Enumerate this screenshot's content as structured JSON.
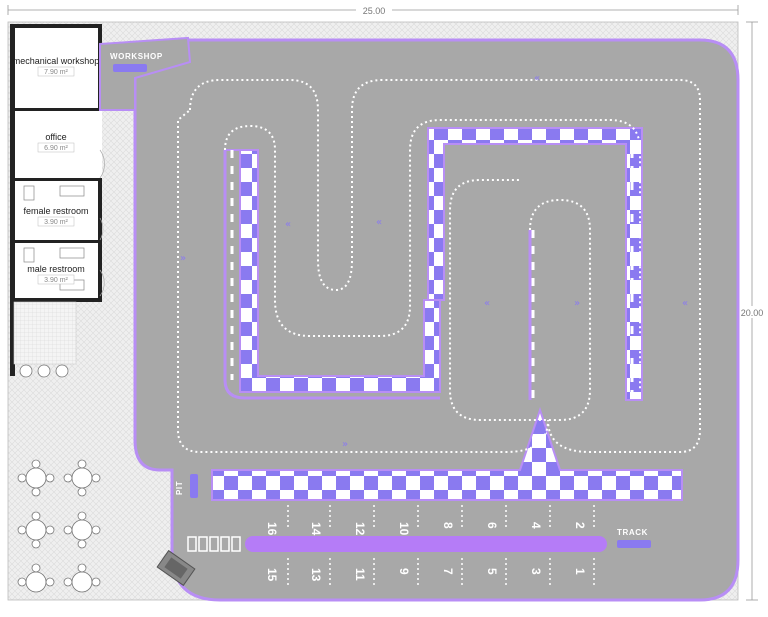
{
  "plan": {
    "width_label": "25.00",
    "height_label": "20.00",
    "rooms": [
      {
        "name": "mechanical workshop",
        "area": "7.90 m²"
      },
      {
        "name": "office",
        "area": "6.90 m²"
      },
      {
        "name": "female restroom",
        "area": "3.90 m²"
      },
      {
        "name": "male restroom",
        "area": "3.90 m²"
      }
    ],
    "signs": {
      "workshop": "WORKSHOP",
      "track": "TRACK",
      "pit": "PIT"
    },
    "grid_top": [
      "16",
      "14",
      "12",
      "10",
      "8",
      "6",
      "4",
      "2"
    ],
    "grid_bottom": [
      "15",
      "13",
      "11",
      "9",
      "7",
      "5",
      "3",
      "1"
    ]
  },
  "colors": {
    "asphalt": "#a8a8a8",
    "kerb": "#8a7af0",
    "border": "#b88ef5",
    "pit_lane": "#b57cf7",
    "floor": "#ececec"
  }
}
